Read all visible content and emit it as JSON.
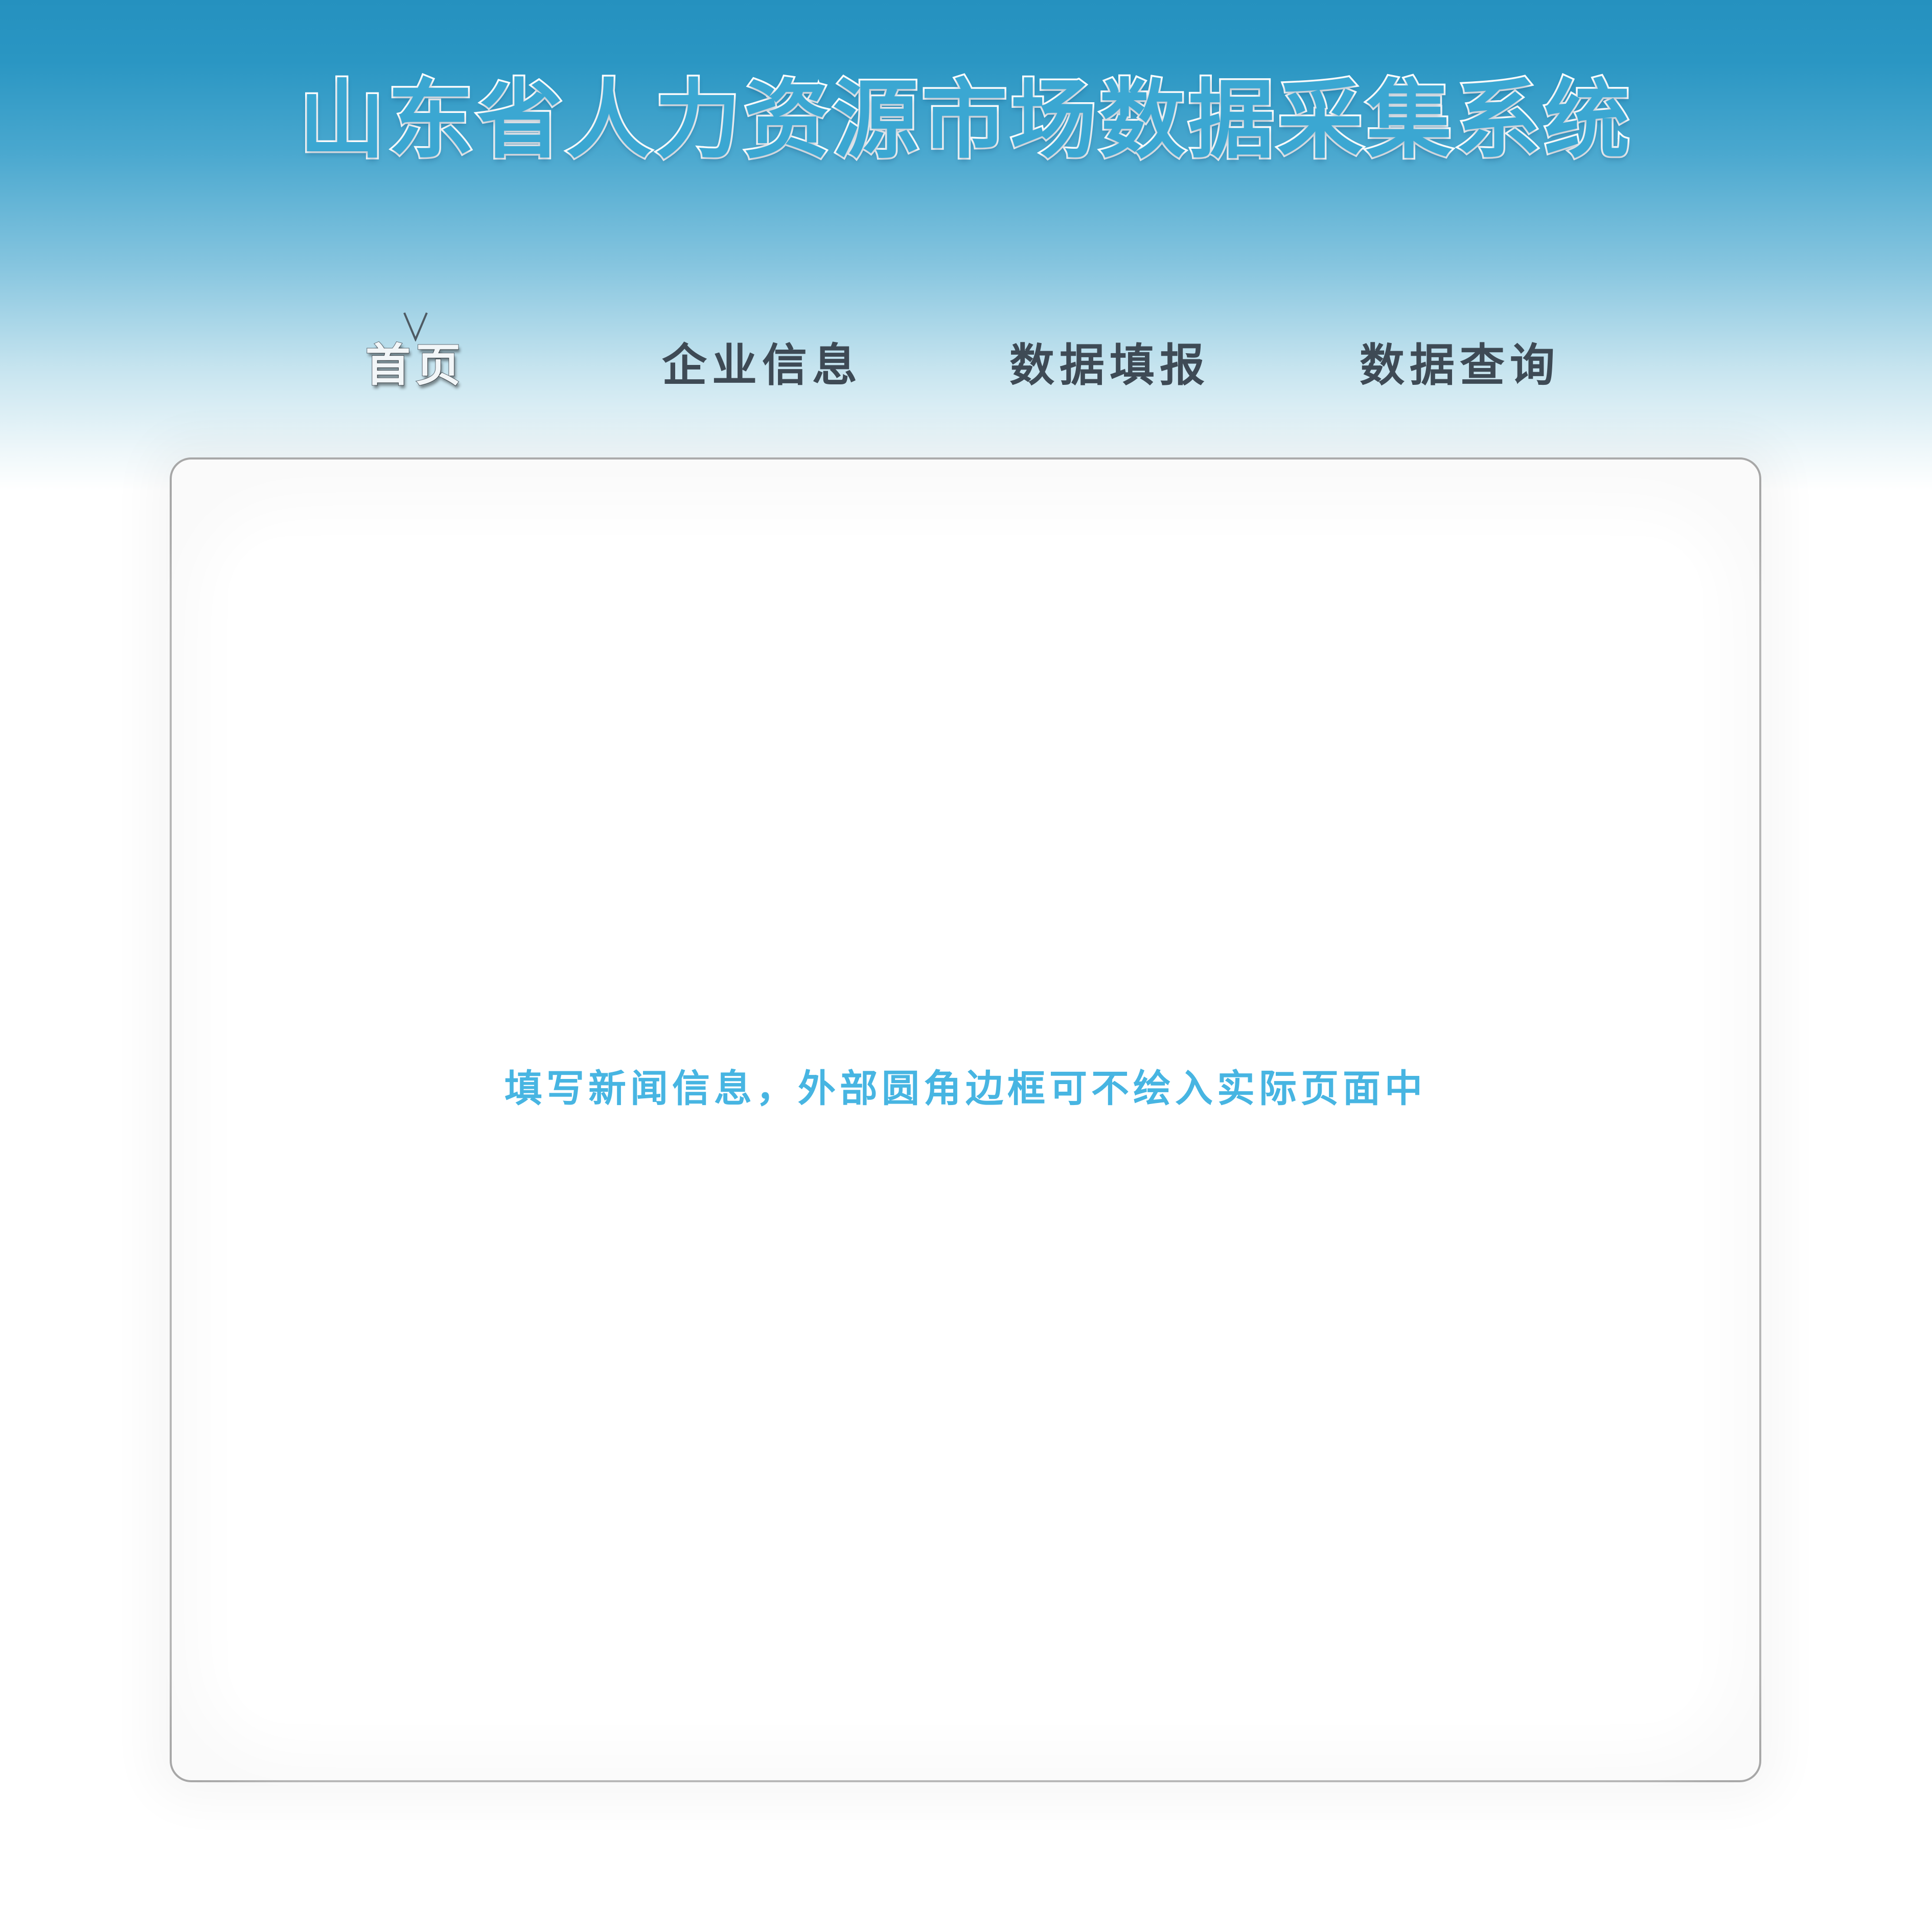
{
  "header": {
    "title": "山东省人力资源市场数据采集系统"
  },
  "nav": {
    "items": [
      {
        "label": "首页",
        "active": true
      },
      {
        "label": "企业信息",
        "active": false
      },
      {
        "label": "数据填报",
        "active": false
      },
      {
        "label": "数据查询",
        "active": false
      }
    ],
    "active_marker_icon": "chevron-down-icon"
  },
  "main": {
    "placeholder_text": "填写新闻信息，外部圆角边框可不绘入实际页面中"
  },
  "colors": {
    "header_gradient_top": "#2591bf",
    "title_fill": "#3ba7d2",
    "title_stroke": "#ffffff",
    "nav_text": "#3e4a55",
    "content_text": "#47b5e2",
    "panel_border": "#a7a7a7"
  }
}
